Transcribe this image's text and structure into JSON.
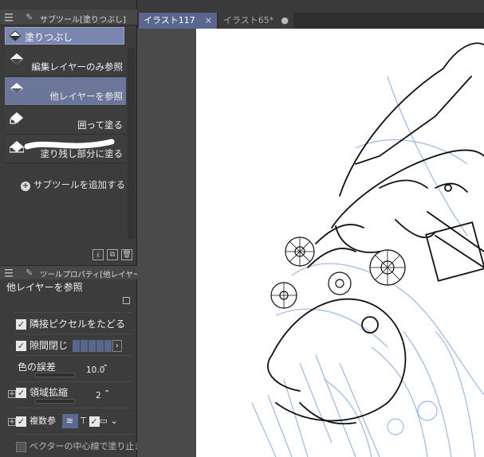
{
  "subtool_panel": {
    "title": "サブツール[塗りつぶし]",
    "main_subtool": "塗りつぶし",
    "items": [
      {
        "label": "編集レイヤーのみ参照",
        "selected": false
      },
      {
        "label": "他レイヤーを参照",
        "selected": true
      },
      {
        "label": "囲って塗る",
        "selected": false
      },
      {
        "label": "塗り残し部分に塗る",
        "selected": false
      }
    ],
    "add_subtool": "サブツールを追加する"
  },
  "property_panel": {
    "title": "ツールプロパティ[他レイヤーを参",
    "subtool_name": "他レイヤーを参照",
    "follow_adjacent": "隣接ピクセルをたどる",
    "close_gap": "隙間閉じ",
    "color_margin_label": "色の誤差",
    "color_margin_value": "10.0",
    "area_scaling_label": "領域拡縮",
    "area_scaling_value": "2",
    "multi_refer": "複数参",
    "vector_center": "ベクターの中心線で塗り止まる"
  },
  "tabs": [
    {
      "label": "イラスト117",
      "active": true
    },
    {
      "label": "イラスト65*",
      "active": false
    }
  ],
  "colors": {
    "accent": "#6b7699",
    "line_blue": "#9bb8e6",
    "ink": "#111111"
  }
}
